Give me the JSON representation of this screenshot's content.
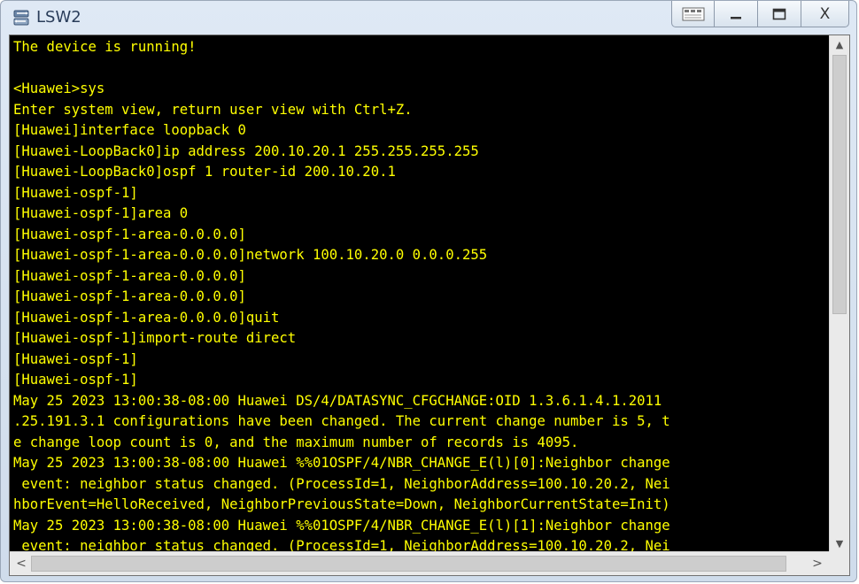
{
  "window": {
    "title": "LSW2",
    "app_icon": "switch-icon",
    "controls": {
      "restore_extra_icon": "panel-icon",
      "minimize_label": "—",
      "maximize_label": "☐",
      "close_label": "X"
    }
  },
  "terminal": {
    "colors": {
      "background": "#000000",
      "text": "#ffff00"
    },
    "lines": [
      "The device is running!",
      "",
      "<Huawei>sys",
      "Enter system view, return user view with Ctrl+Z.",
      "[Huawei]interface loopback 0",
      "[Huawei-LoopBack0]ip address 200.10.20.1 255.255.255.255",
      "[Huawei-LoopBack0]ospf 1 router-id 200.10.20.1",
      "[Huawei-ospf-1]",
      "[Huawei-ospf-1]area 0",
      "[Huawei-ospf-1-area-0.0.0.0]",
      "[Huawei-ospf-1-area-0.0.0.0]network 100.10.20.0 0.0.0.255",
      "[Huawei-ospf-1-area-0.0.0.0]",
      "[Huawei-ospf-1-area-0.0.0.0]",
      "[Huawei-ospf-1-area-0.0.0.0]quit",
      "[Huawei-ospf-1]import-route direct",
      "[Huawei-ospf-1]",
      "[Huawei-ospf-1]",
      "May 25 2023 13:00:38-08:00 Huawei DS/4/DATASYNC_CFGCHANGE:OID 1.3.6.1.4.1.2011",
      ".25.191.3.1 configurations have been changed. The current change number is 5, t",
      "e change loop count is 0, and the maximum number of records is 4095.",
      "May 25 2023 13:00:38-08:00 Huawei %%01OSPF/4/NBR_CHANGE_E(l)[0]:Neighbor change",
      " event: neighbor status changed. (ProcessId=1, NeighborAddress=100.10.20.2, Nei",
      "hborEvent=HelloReceived, NeighborPreviousState=Down, NeighborCurrentState=Init)",
      "May 25 2023 13:00:38-08:00 Huawei %%01OSPF/4/NBR_CHANGE_E(l)[1]:Neighbor change",
      " event: neighbor status changed. (ProcessId=1, NeighborAddress=100.10.20.2, Nei"
    ]
  },
  "scrollbars": {
    "vertical_position": 0.0,
    "horizontal_position": 0.0
  }
}
